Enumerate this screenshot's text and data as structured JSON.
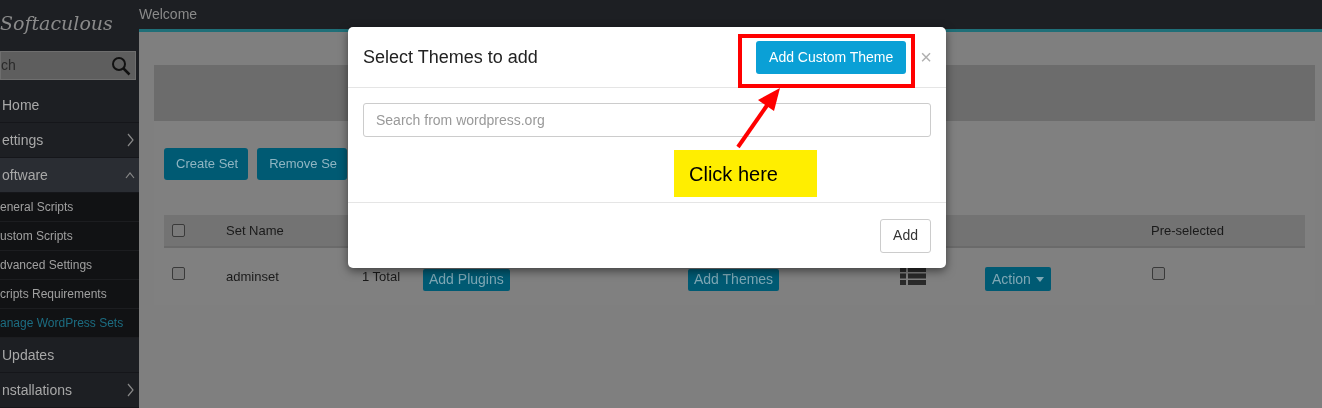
{
  "logo": "Softaculous",
  "header": {
    "title": "Welcome"
  },
  "sidebar": {
    "search": {
      "value": "ch"
    },
    "items": [
      {
        "label": "Home",
        "kind": "item",
        "selected": false
      },
      {
        "label": "ettings",
        "kind": "group",
        "expanded": false,
        "selected": false
      },
      {
        "label": "oftware",
        "kind": "group",
        "expanded": true,
        "selected": false,
        "children": [
          {
            "label": "eneral Scripts",
            "selected": false
          },
          {
            "label": "ustom Scripts",
            "selected": false
          },
          {
            "label": "dvanced Settings",
            "selected": false
          },
          {
            "label": "cripts Requirements",
            "selected": false
          },
          {
            "label": "anage WordPress Sets",
            "selected": true
          }
        ]
      },
      {
        "label": "Updates",
        "kind": "item",
        "selected": false
      },
      {
        "label": "nstallations",
        "kind": "group",
        "expanded": false,
        "selected": false
      }
    ]
  },
  "toolbar": {
    "buttons": [
      "Create Set",
      "Remove Se"
    ]
  },
  "table": {
    "header_checkbox": {
      "checked": false
    },
    "set_name": "Set Name",
    "preselected": "Pre-selected",
    "rows": [
      {
        "checked": false,
        "set_name": "adminset",
        "total": "1 Total",
        "plugins_button": "Add Plugins",
        "themes_button": "Add Themes",
        "action_button": "Action",
        "preselected": false
      }
    ]
  },
  "modal": {
    "title": "Select Themes to add",
    "custom_button": "Add Custom Theme",
    "close": "×",
    "search": {
      "placeholder": "Search from wordpress.org"
    },
    "add_button": "Add"
  },
  "callout": {
    "text": "Click here"
  }
}
